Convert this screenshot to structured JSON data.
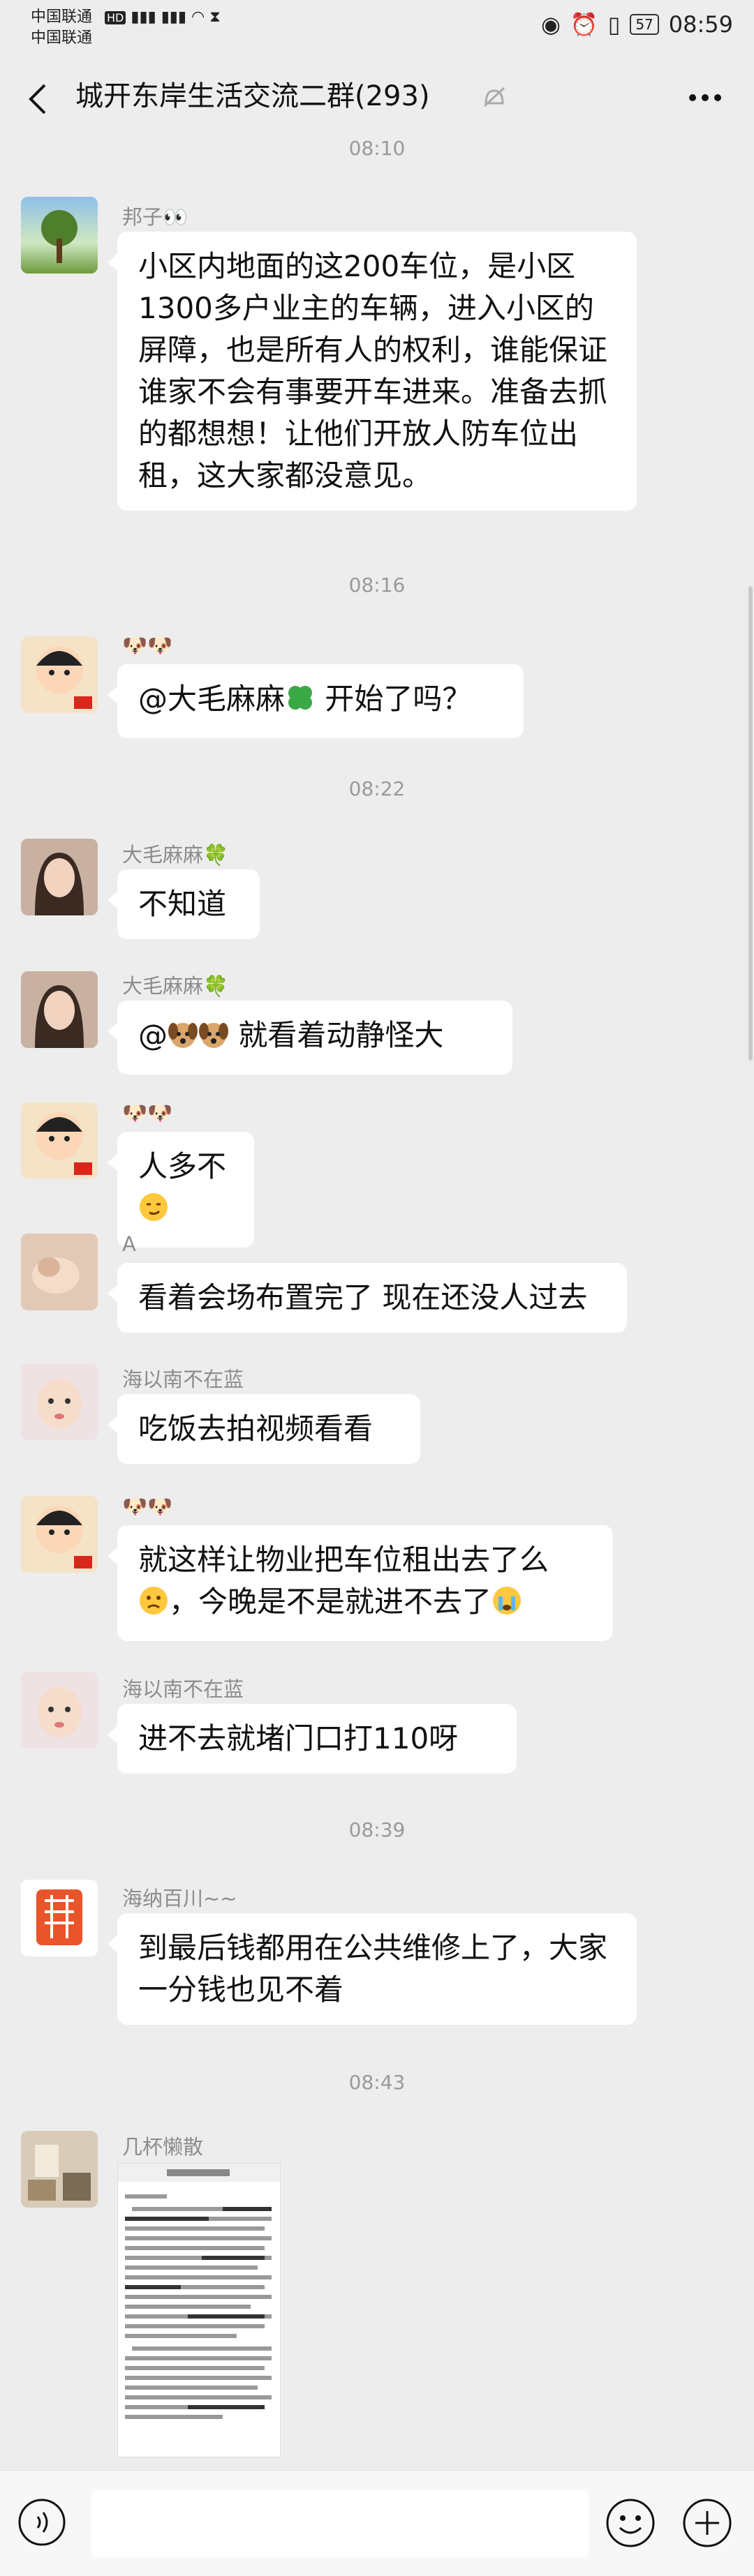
{
  "status_bar": {
    "carrier1": "中国联通",
    "carrier2": "中国联通",
    "battery": "57",
    "time": "08:59"
  },
  "header": {
    "title": "城开东岸生活交流二群(293)"
  },
  "messages": [
    {
      "type": "time",
      "text": "08:10"
    },
    {
      "type": "msg",
      "sender": "邦子👀",
      "text": "小区内地面的这200车位，是小区1300多户业主的车辆，进入小区的屏障，也是所有人的权利，谁能保证谁家不会有事要开车进来。准备去抓的都想想！让他们开放人防车位出租，这大家都没意见。"
    },
    {
      "type": "time",
      "text": "08:16"
    },
    {
      "type": "msg",
      "sender": "🐶🐶",
      "text_before": "@大毛麻麻",
      "text_after": " 开始了吗？"
    },
    {
      "type": "time",
      "text": "08:22"
    },
    {
      "type": "msg",
      "sender": "大毛麻麻🍀",
      "text": "不知道"
    },
    {
      "type": "msg",
      "sender": "大毛麻麻🍀",
      "text_before": "@",
      "text_after": " 就看着动静怪大"
    },
    {
      "type": "msg",
      "sender": "🐶🐶",
      "text": "人多不"
    },
    {
      "type": "msg",
      "sender": "A",
      "text": "看着会场布置完了 现在还没人过去"
    },
    {
      "type": "msg",
      "sender": "海以南不在蓝",
      "text": "吃饭去拍视频看看"
    },
    {
      "type": "msg",
      "sender": "🐶🐶",
      "text_line1": "就这样让物业把车位租出去了么",
      "text_line2": "，今晚是不是就进不去了"
    },
    {
      "type": "msg",
      "sender": "海以南不在蓝",
      "text": "进不去就堵门口打110呀"
    },
    {
      "type": "time",
      "text": "08:39"
    },
    {
      "type": "msg",
      "sender": "海纳百川~~",
      "text": "到最后钱都用在公共维修上了，大家一分钱也见不着"
    },
    {
      "type": "time",
      "text": "08:43"
    },
    {
      "type": "msg",
      "sender": "几杯懒散",
      "image": true
    }
  ],
  "colors": {
    "background": "#ededed",
    "bubble": "#ffffff",
    "time": "#9a9a9a"
  }
}
